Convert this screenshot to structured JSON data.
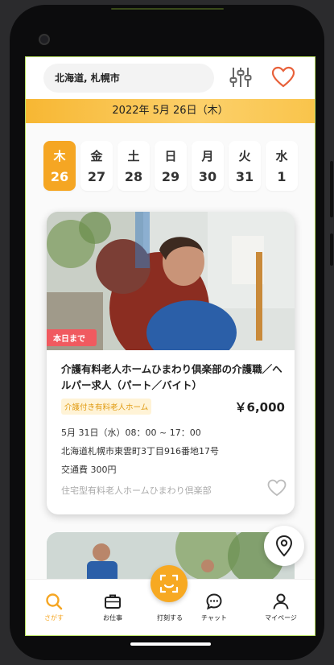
{
  "header": {
    "location": "北海道, 札幌市",
    "filter_icon": "sliders-icon",
    "favorite_icon": "heart-icon"
  },
  "date_banner": "2022年 5月 26日（木）",
  "days": [
    {
      "weekday": "木",
      "date": "26",
      "active": true
    },
    {
      "weekday": "金",
      "date": "27"
    },
    {
      "weekday": "土",
      "date": "28"
    },
    {
      "weekday": "日",
      "date": "29"
    },
    {
      "weekday": "月",
      "date": "30"
    },
    {
      "weekday": "火",
      "date": "31"
    },
    {
      "weekday": "水",
      "date": "1"
    }
  ],
  "job": {
    "badge": "本日まで",
    "title": "介護有料老人ホームひまわり倶楽部の介護職／ヘルパー求人（パート／バイト）",
    "tag": "介護付き有料老人ホーム",
    "price": "￥6,000",
    "schedule": "5月 31日（水）08：00 ~ 17：00",
    "address": "北海道札幌市東雲町3丁目916番地17号",
    "transport": "交通費 300円",
    "company": "住宅型有料老人ホームひまわり倶楽部"
  },
  "nav": {
    "search": "さがす",
    "work": "お仕事",
    "clock_in": "打刻する",
    "chat": "チャット",
    "mypage": "マイページ"
  },
  "colors": {
    "accent": "#f5a623",
    "badge": "#f05a5f",
    "heart": "#e8613a"
  }
}
